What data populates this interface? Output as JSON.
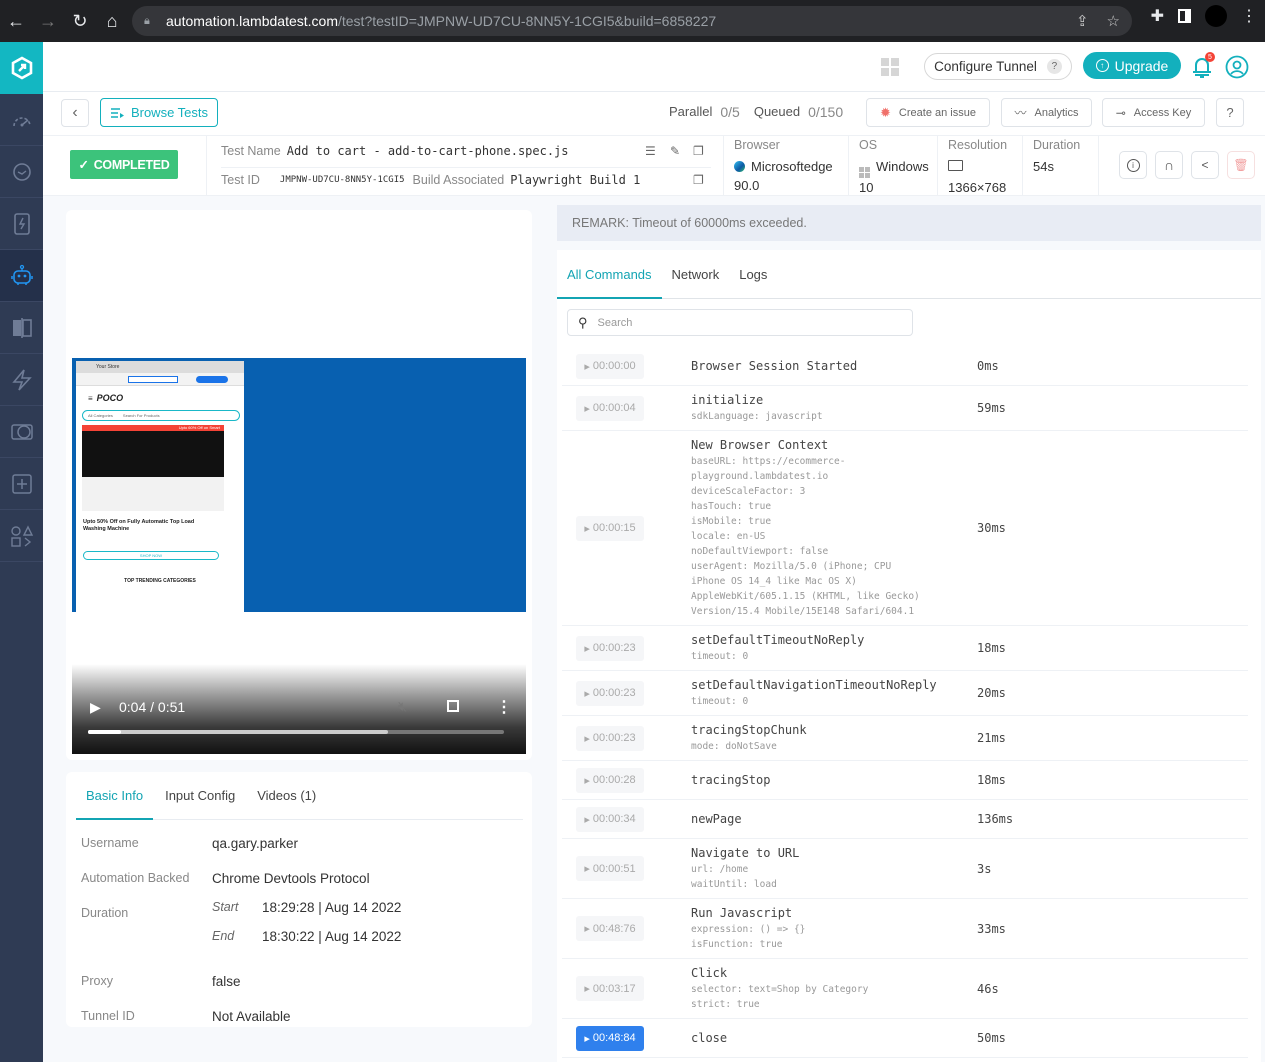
{
  "browser": {
    "url_host": "automation.lambdatest.com",
    "url_path": "/test?testID=JMPNW-UD7CU-8NN5Y-1CGI5&build=6858227"
  },
  "sidebar": {
    "items": [
      {
        "name": "analytics-dashboard",
        "icon": "speedometer-icon"
      },
      {
        "name": "realtime",
        "icon": "clock-icon"
      },
      {
        "name": "app-testing",
        "icon": "mobile-bolt-icon"
      },
      {
        "name": "automation",
        "icon": "robot-icon",
        "active": true
      },
      {
        "name": "visual-ui",
        "icon": "compare-icon"
      },
      {
        "name": "hyperexecute",
        "icon": "lightning-icon"
      },
      {
        "name": "smart-ui",
        "icon": "circles-icon"
      },
      {
        "name": "add",
        "icon": "plus-square-icon"
      },
      {
        "name": "integrations",
        "icon": "shapes-icon"
      }
    ]
  },
  "header": {
    "configure_tunnel": "Configure Tunnel",
    "tunnel_help": "?",
    "upgrade": "Upgrade",
    "notifications_count": "5"
  },
  "subbar": {
    "browse_tests": "Browse Tests",
    "parallel_label": "Parallel",
    "parallel_value": "0/5",
    "queued_label": "Queued",
    "queued_value": "0/150",
    "create_issue": "Create an issue",
    "analytics": "Analytics",
    "access_key": "Access Key",
    "help": "?"
  },
  "test": {
    "status": "COMPLETED",
    "test_name_label": "Test Name",
    "test_name": "Add to cart - add-to-cart-phone.spec.js",
    "test_id_label": "Test ID",
    "test_id": "JMPNW-UD7CU-8NN5Y-1CGI5",
    "build_label": "Build Associated",
    "build": "Playwright Build 1",
    "browser_label": "Browser",
    "browser": "Microsoftedge",
    "browser_version": "90.0",
    "os_label": "OS",
    "os": "Windows",
    "os_version": "10",
    "resolution_label": "Resolution",
    "resolution": "1366×768",
    "duration_label": "Duration",
    "duration": "54s"
  },
  "video": {
    "current_time": "0:04",
    "total_time": "0:51",
    "time_display": "0:04 / 0:51",
    "played_fraction": 0.08,
    "buffered_fraction": 0.72,
    "preview": {
      "tab_title": "Your Store",
      "brand": "POCO",
      "category_select": "All Categories",
      "search_placeholder": "Search For Products",
      "promo_bar": "Upto 60% Off on Smart",
      "headline": "Upto 50% Off on Fully Automatic Top Load Washing Machine",
      "shop_now": "SHOP NOW",
      "trending": "TOP TRENDING CATEGORIES"
    }
  },
  "basic_info": {
    "tabs": [
      "Basic Info",
      "Input Config",
      "Videos (1)"
    ],
    "username_label": "Username",
    "username": "qa.gary.parker",
    "automation_label": "Automation Backed",
    "automation": "Chrome Devtools Protocol",
    "duration_label": "Duration",
    "start_label": "Start",
    "start": "18:29:28 | Aug 14 2022",
    "end_label": "End",
    "end": "18:30:22 | Aug 14 2022",
    "proxy_label": "Proxy",
    "proxy": "false",
    "tunnel_label": "Tunnel ID",
    "tunnel": "Not Available"
  },
  "remark": "REMARK: Timeout of 60000ms exceeded.",
  "commands_tabs": [
    "All Commands",
    "Network",
    "Logs"
  ],
  "search_placeholder": "Search",
  "commands": [
    {
      "time": "00:00:00",
      "name": "Browser Session Started",
      "args": [],
      "duration": "0ms"
    },
    {
      "time": "00:00:04",
      "name": "initialize",
      "args": [
        "sdkLanguage: javascript"
      ],
      "duration": "59ms"
    },
    {
      "time": "00:00:15",
      "name": "New Browser Context",
      "args": [
        "baseURL: https://ecommerce-",
        "playground.lambdatest.io",
        "deviceScaleFactor: 3",
        "hasTouch: true",
        "isMobile: true",
        "locale: en-US",
        "noDefaultViewport: false",
        "userAgent: Mozilla/5.0 (iPhone; CPU",
        "iPhone OS 14_4 like Mac OS X)",
        "AppleWebKit/605.1.15 (KHTML, like Gecko)",
        "Version/15.4 Mobile/15E148 Safari/604.1"
      ],
      "duration": "30ms"
    },
    {
      "time": "00:00:23",
      "name": "setDefaultTimeoutNoReply",
      "args": [
        "timeout: 0"
      ],
      "duration": "18ms"
    },
    {
      "time": "00:00:23",
      "name": "setDefaultNavigationTimeoutNoReply",
      "args": [
        "timeout: 0"
      ],
      "duration": "20ms"
    },
    {
      "time": "00:00:23",
      "name": "tracingStopChunk",
      "args": [
        "mode: doNotSave"
      ],
      "duration": "21ms"
    },
    {
      "time": "00:00:28",
      "name": "tracingStop",
      "args": [],
      "duration": "18ms"
    },
    {
      "time": "00:00:34",
      "name": "newPage",
      "args": [],
      "duration": "136ms"
    },
    {
      "time": "00:00:51",
      "name": "Navigate to URL",
      "args": [
        "url: /home",
        "waitUntil: load"
      ],
      "duration": "3s"
    },
    {
      "time": "00:48:76",
      "name": "Run Javascript",
      "args": [
        "expression: () => {}",
        "isFunction: true"
      ],
      "duration": "33ms"
    },
    {
      "time": "00:03:17",
      "name": "Click",
      "args": [
        "selector: text=Shop by Category",
        "strict: true"
      ],
      "duration": "46s"
    },
    {
      "time": "00:48:84",
      "name": "close",
      "args": [],
      "duration": "50ms",
      "active": true
    }
  ],
  "colors": {
    "accent": "#13b0bd",
    "status_completed": "#3cc37b",
    "sidebar_bg": "#2f3b54",
    "active_timestamp": "#2f80ed",
    "video_bg": "#0860b0"
  }
}
